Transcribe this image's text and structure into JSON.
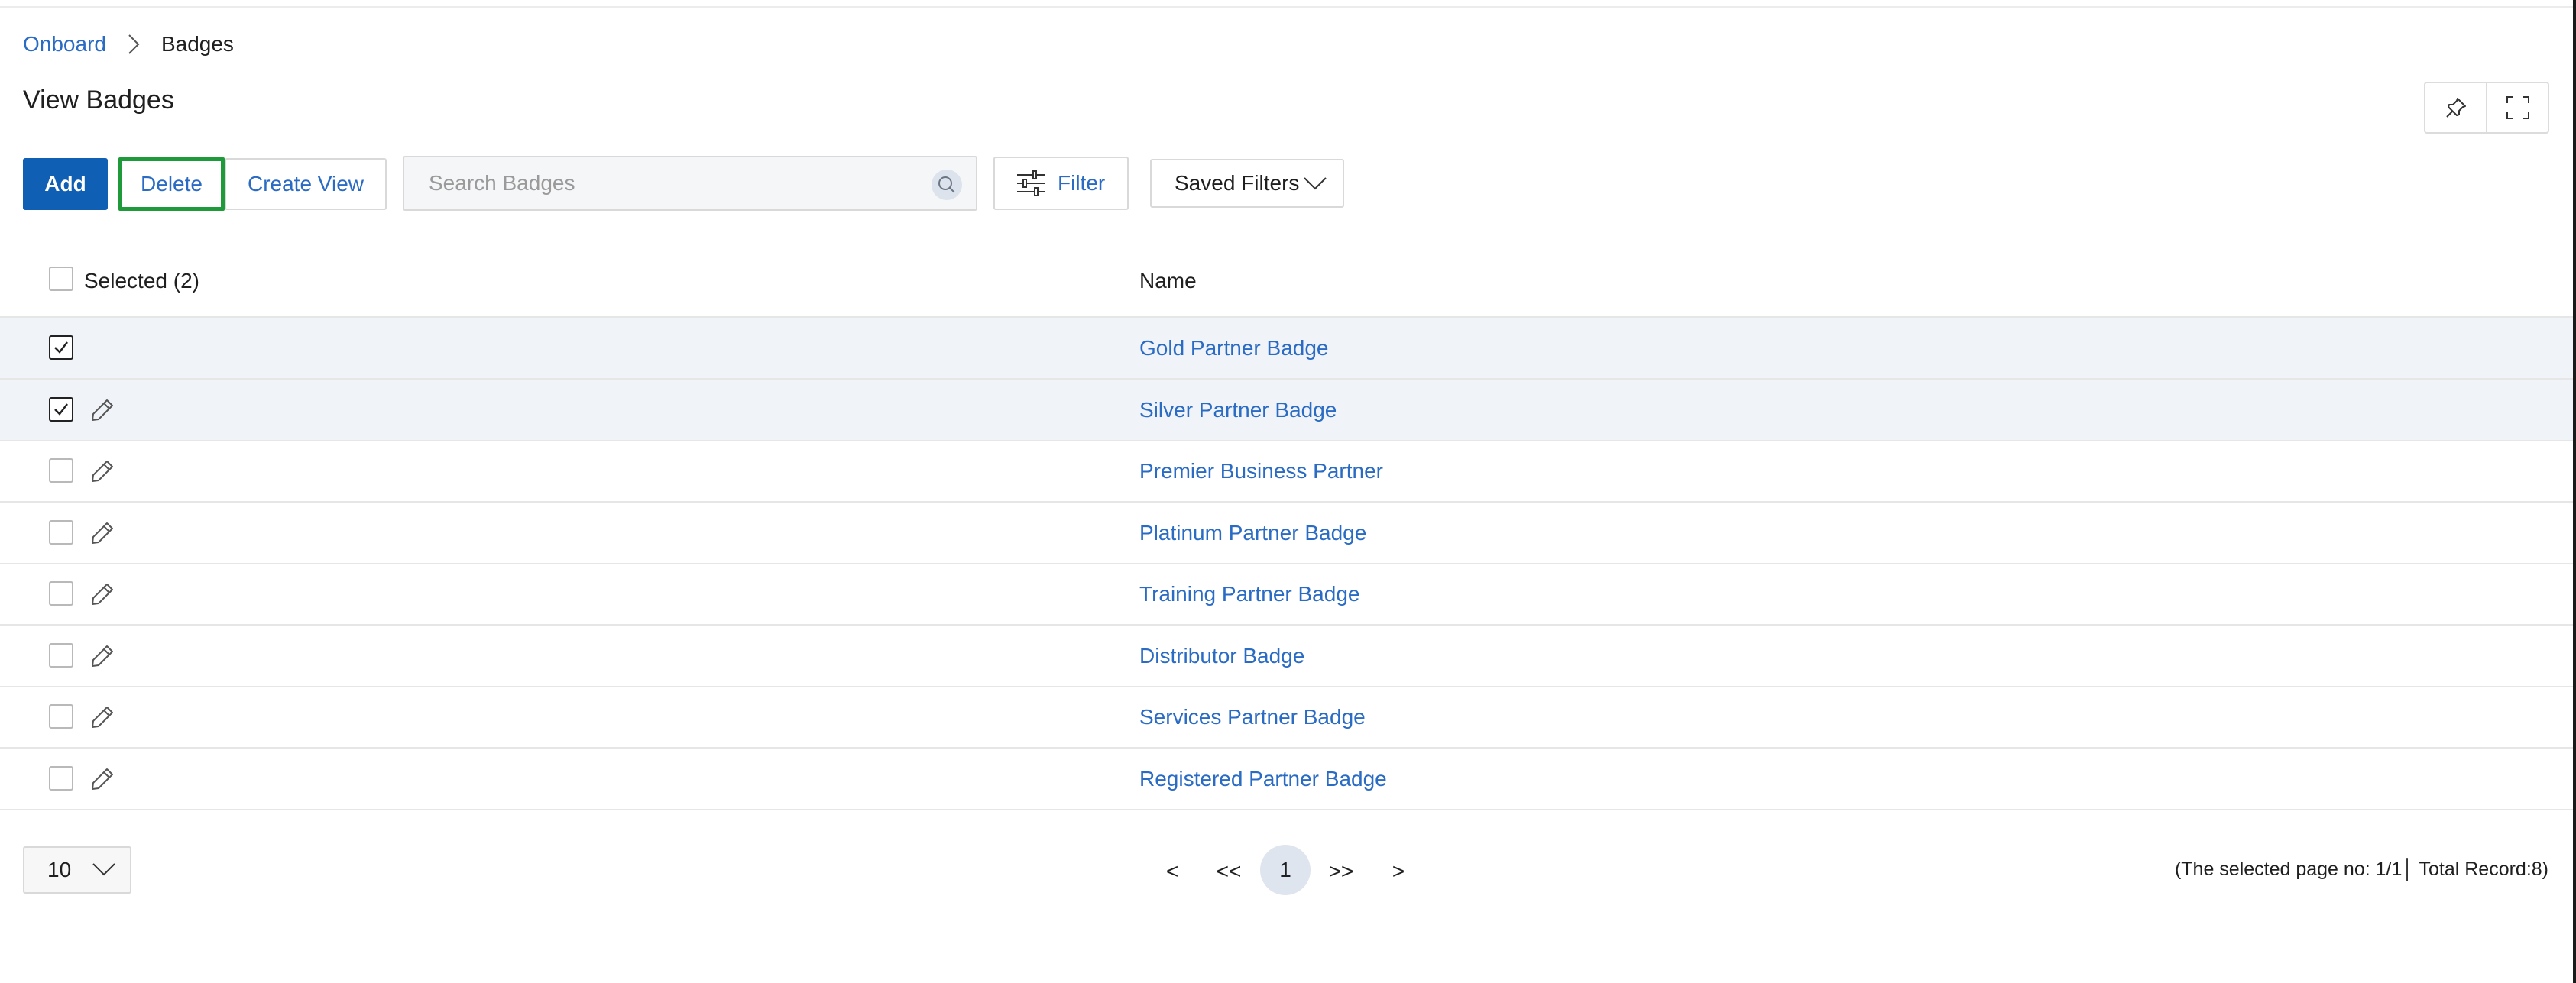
{
  "breadcrumb": {
    "parent": "Onboard",
    "current": "Badges"
  },
  "page": {
    "title": "View Badges"
  },
  "toolbar": {
    "add_label": "Add",
    "delete_label": "Delete",
    "create_view_label": "Create View",
    "search_placeholder": "Search Badges",
    "search_value": "",
    "filter_label": "Filter",
    "saved_filters_label": "Saved Filters"
  },
  "table": {
    "columns": {
      "selected": "Selected (2)",
      "name": "Name"
    },
    "rows": [
      {
        "name": "Gold Partner Badge",
        "checked": true
      },
      {
        "name": "Silver Partner Badge",
        "checked": true
      },
      {
        "name": "Premier Business Partner",
        "checked": false
      },
      {
        "name": "Platinum Partner Badge",
        "checked": false
      },
      {
        "name": "Training Partner Badge",
        "checked": false
      },
      {
        "name": "Distributor Badge",
        "checked": false
      },
      {
        "name": "Services Partner Badge",
        "checked": false
      },
      {
        "name": "Registered Partner Badge",
        "checked": false
      }
    ]
  },
  "pagination": {
    "page_size": "10",
    "prev": "<",
    "first": "<<",
    "current": "1",
    "last": ">>",
    "next": ">",
    "status": "(The selected page no: 1/1│ Total Record:8)"
  },
  "icons": {
    "breadcrumb_separator": "chevron-right-icon",
    "search": "search-icon",
    "filter": "sliders-icon",
    "dropdown": "chevron-down-icon",
    "pin": "pin-icon",
    "expand": "expand-icon",
    "edit": "pencil-icon",
    "checkbox": "check-icon"
  },
  "colors": {
    "primary": "#0f5fb5",
    "link": "#2a6bc4",
    "highlight_border": "#1f9a3a",
    "selected_row": "#f0f3f7"
  }
}
